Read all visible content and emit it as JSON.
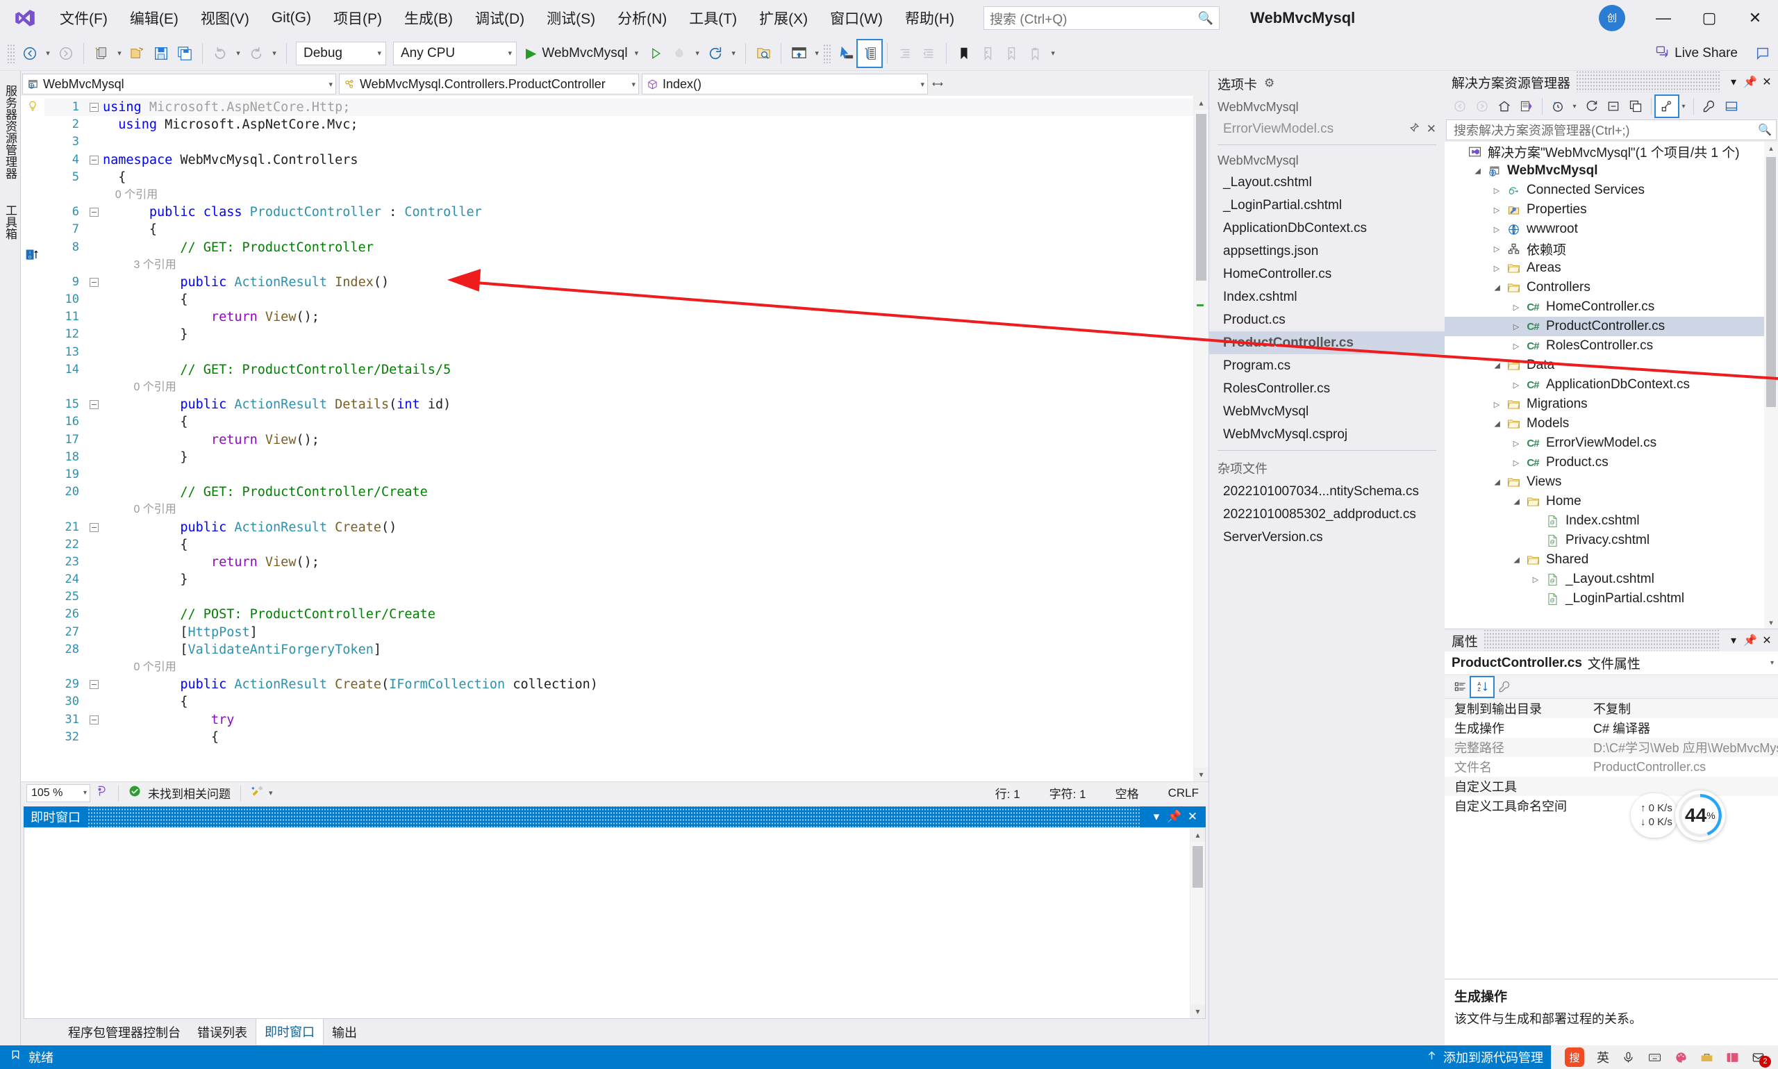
{
  "window": {
    "project_title": "WebMvcMysql",
    "avatar_initials": "创",
    "minimize": "—",
    "maximize": "▢",
    "close": "✕"
  },
  "menu": {
    "items": [
      {
        "label": "文件(F)"
      },
      {
        "label": "编辑(E)"
      },
      {
        "label": "视图(V)"
      },
      {
        "label": "Git(G)"
      },
      {
        "label": "项目(P)"
      },
      {
        "label": "生成(B)"
      },
      {
        "label": "调试(D)"
      },
      {
        "label": "测试(S)"
      },
      {
        "label": "分析(N)"
      },
      {
        "label": "工具(T)"
      },
      {
        "label": "扩展(X)"
      },
      {
        "label": "窗口(W)"
      },
      {
        "label": "帮助(H)"
      }
    ]
  },
  "search": {
    "placeholder": "搜索 (Ctrl+Q)",
    "icon": "search-icon"
  },
  "toolbar": {
    "config": "Debug",
    "platform": "Any CPU",
    "run_target": "WebMvcMysql",
    "live_share": "Live Share",
    "icons": [
      "navigate-back-icon",
      "navigate-forward-icon",
      "new-project-icon",
      "open-file-icon",
      "save-icon",
      "save-all-icon",
      "undo-icon",
      "redo-icon",
      "start-debug-icon",
      "hot-reload-icon",
      "restart-icon",
      "find-in-files-icon",
      "toggle-preview-icon",
      "pointer-select-icon",
      "solution-explorer-icon",
      "indent-icon",
      "outdent-icon",
      "bookmark-icon",
      "prev-bookmark-icon",
      "next-bookmark-icon",
      "clear-bookmarks-icon"
    ]
  },
  "left_dock": {
    "tabs": [
      "服务器资源管理器",
      "工具箱"
    ]
  },
  "navbar": {
    "project": "WebMvcMysql",
    "type": "WebMvcMysql.Controllers.ProductController",
    "member": "Index()",
    "project_icon": "web-project-icon",
    "type_icon": "class-icon",
    "member_icon": "method-icon"
  },
  "editor": {
    "lines": [
      {
        "n": "1",
        "fold": "minus",
        "highlight": true,
        "tokens": [
          {
            "t": "using ",
            "c": "k"
          },
          {
            "t": "Microsoft.AspNetCore.Http;",
            "c": "gray"
          }
        ]
      },
      {
        "n": "2",
        "fold": "",
        "tokens": [
          {
            "t": "  using ",
            "c": "k"
          },
          {
            "t": "Microsoft.AspNetCore.Mvc;",
            "c": "ns"
          }
        ]
      },
      {
        "n": "3",
        "fold": "",
        "tokens": []
      },
      {
        "n": "4",
        "fold": "minus",
        "tokens": [
          {
            "t": "namespace ",
            "c": "k"
          },
          {
            "t": "WebMvcMysql.Controllers",
            "c": "ns"
          }
        ]
      },
      {
        "n": "5",
        "fold": "",
        "tokens": [
          {
            "t": "  {",
            "c": "ns"
          }
        ]
      },
      {
        "n": "",
        "fold": "",
        "ref": "    0 个引用"
      },
      {
        "n": "6",
        "fold": "minus",
        "tokens": [
          {
            "t": "      public class ",
            "c": "k"
          },
          {
            "t": "ProductController",
            "c": "t"
          },
          {
            "t": " : ",
            "c": "ns"
          },
          {
            "t": "Controller",
            "c": "t"
          }
        ]
      },
      {
        "n": "7",
        "fold": "",
        "tokens": [
          {
            "t": "      {",
            "c": "ns"
          }
        ]
      },
      {
        "n": "8",
        "fold": "",
        "tokens": [
          {
            "t": "          // GET: ProductController",
            "c": "cm"
          }
        ]
      },
      {
        "n": "",
        "fold": "",
        "ref": "          3 个引用"
      },
      {
        "n": "9",
        "fold": "minus",
        "tokens": [
          {
            "t": "          public ",
            "c": "k"
          },
          {
            "t": "ActionResult",
            "c": "t"
          },
          {
            "t": " ",
            "c": "ns"
          },
          {
            "t": "Index",
            "c": "mth"
          },
          {
            "t": "()",
            "c": "ns"
          }
        ]
      },
      {
        "n": "10",
        "fold": "",
        "tokens": [
          {
            "t": "          {",
            "c": "ns"
          }
        ]
      },
      {
        "n": "11",
        "fold": "",
        "tokens": [
          {
            "t": "              return ",
            "c": "ctl"
          },
          {
            "t": "View",
            "c": "mth"
          },
          {
            "t": "();",
            "c": "ns"
          }
        ]
      },
      {
        "n": "12",
        "fold": "",
        "tokens": [
          {
            "t": "          }",
            "c": "ns"
          }
        ]
      },
      {
        "n": "13",
        "fold": "",
        "tokens": []
      },
      {
        "n": "14",
        "fold": "",
        "tokens": [
          {
            "t": "          // GET: ProductController/Details/5",
            "c": "cm"
          }
        ]
      },
      {
        "n": "",
        "fold": "",
        "ref": "          0 个引用"
      },
      {
        "n": "15",
        "fold": "minus",
        "tokens": [
          {
            "t": "          public ",
            "c": "k"
          },
          {
            "t": "ActionResult",
            "c": "t"
          },
          {
            "t": " ",
            "c": "ns"
          },
          {
            "t": "Details",
            "c": "mth"
          },
          {
            "t": "(",
            "c": "ns"
          },
          {
            "t": "int",
            "c": "k"
          },
          {
            "t": " ",
            "c": "ns"
          },
          {
            "t": "id",
            "c": "par"
          },
          {
            "t": ")",
            "c": "ns"
          }
        ]
      },
      {
        "n": "16",
        "fold": "",
        "tokens": [
          {
            "t": "          {",
            "c": "ns"
          }
        ]
      },
      {
        "n": "17",
        "fold": "",
        "tokens": [
          {
            "t": "              return ",
            "c": "ctl"
          },
          {
            "t": "View",
            "c": "mth"
          },
          {
            "t": "();",
            "c": "ns"
          }
        ]
      },
      {
        "n": "18",
        "fold": "",
        "tokens": [
          {
            "t": "          }",
            "c": "ns"
          }
        ]
      },
      {
        "n": "19",
        "fold": "",
        "tokens": []
      },
      {
        "n": "20",
        "fold": "",
        "tokens": [
          {
            "t": "          // GET: ProductController/Create",
            "c": "cm"
          }
        ]
      },
      {
        "n": "",
        "fold": "",
        "ref": "          0 个引用"
      },
      {
        "n": "21",
        "fold": "minus",
        "tokens": [
          {
            "t": "          public ",
            "c": "k"
          },
          {
            "t": "ActionResult",
            "c": "t"
          },
          {
            "t": " ",
            "c": "ns"
          },
          {
            "t": "Create",
            "c": "mth"
          },
          {
            "t": "()",
            "c": "ns"
          }
        ]
      },
      {
        "n": "22",
        "fold": "",
        "tokens": [
          {
            "t": "          {",
            "c": "ns"
          }
        ]
      },
      {
        "n": "23",
        "fold": "",
        "tokens": [
          {
            "t": "              return ",
            "c": "ctl"
          },
          {
            "t": "View",
            "c": "mth"
          },
          {
            "t": "();",
            "c": "ns"
          }
        ]
      },
      {
        "n": "24",
        "fold": "",
        "tokens": [
          {
            "t": "          }",
            "c": "ns"
          }
        ]
      },
      {
        "n": "25",
        "fold": "",
        "tokens": []
      },
      {
        "n": "26",
        "fold": "",
        "tokens": [
          {
            "t": "          // POST: ProductController/Create",
            "c": "cm"
          }
        ]
      },
      {
        "n": "27",
        "fold": "",
        "tokens": [
          {
            "t": "          [",
            "c": "ns"
          },
          {
            "t": "HttpPost",
            "c": "t"
          },
          {
            "t": "]",
            "c": "ns"
          }
        ]
      },
      {
        "n": "28",
        "fold": "",
        "tokens": [
          {
            "t": "          [",
            "c": "ns"
          },
          {
            "t": "ValidateAntiForgeryToken",
            "c": "t"
          },
          {
            "t": "]",
            "c": "ns"
          }
        ]
      },
      {
        "n": "",
        "fold": "",
        "ref": "          0 个引用"
      },
      {
        "n": "29",
        "fold": "minus",
        "tokens": [
          {
            "t": "          public ",
            "c": "k"
          },
          {
            "t": "ActionResult",
            "c": "t"
          },
          {
            "t": " ",
            "c": "ns"
          },
          {
            "t": "Create",
            "c": "mth"
          },
          {
            "t": "(",
            "c": "ns"
          },
          {
            "t": "IFormCollection",
            "c": "t"
          },
          {
            "t": " collection)",
            "c": "ns"
          }
        ]
      },
      {
        "n": "30",
        "fold": "",
        "tokens": [
          {
            "t": "          {",
            "c": "ns"
          }
        ]
      },
      {
        "n": "31",
        "fold": "minus",
        "tokens": [
          {
            "t": "              try",
            "c": "ctl"
          }
        ]
      },
      {
        "n": "32",
        "fold": "",
        "tokens": [
          {
            "t": "              {",
            "c": "ns"
          }
        ]
      }
    ],
    "status": {
      "zoom": "105 %",
      "issues": "未找到相关问题",
      "line_label": "行: 1",
      "col_label": "字符: 1",
      "spaces": "空格",
      "eol": "CRLF"
    }
  },
  "immediate_window": {
    "title": "即时窗口",
    "tabs": [
      {
        "label": "程序包管理器控制台",
        "selected": false
      },
      {
        "label": "错误列表",
        "selected": false
      },
      {
        "label": "即时窗口",
        "selected": true
      },
      {
        "label": "输出",
        "selected": false
      }
    ],
    "header_buttons": [
      "chevron-down-icon",
      "pin-icon",
      "close-icon"
    ]
  },
  "tab_well": {
    "title": "选项卡",
    "gear": "gear-icon",
    "groups": [
      {
        "name": "WebMvcMysql",
        "items": [
          {
            "label": "ErrorViewModel.cs",
            "dim": true,
            "selected": false,
            "has_pin": true,
            "has_close": true
          }
        ]
      },
      {
        "name": "WebMvcMysql",
        "items": [
          {
            "label": "_Layout.cshtml",
            "dim": false,
            "selected": false
          },
          {
            "label": "_LoginPartial.cshtml",
            "dim": false,
            "selected": false
          },
          {
            "label": "ApplicationDbContext.cs",
            "dim": false,
            "selected": false
          },
          {
            "label": "appsettings.json",
            "dim": false,
            "selected": false
          },
          {
            "label": "HomeController.cs",
            "dim": false,
            "selected": false
          },
          {
            "label": "Index.cshtml",
            "dim": false,
            "selected": false
          },
          {
            "label": "Product.cs",
            "dim": false,
            "selected": false
          },
          {
            "label": "ProductController.cs",
            "dim": false,
            "selected": true
          },
          {
            "label": "Program.cs",
            "dim": false,
            "selected": false
          },
          {
            "label": "RolesController.cs",
            "dim": false,
            "selected": false
          },
          {
            "label": "WebMvcMysql",
            "dim": false,
            "selected": false
          },
          {
            "label": "WebMvcMysql.csproj",
            "dim": false,
            "selected": false
          }
        ]
      },
      {
        "name": "杂项文件",
        "items": [
          {
            "label": "2022101007034...ntitySchema.cs",
            "dim": false,
            "selected": false
          },
          {
            "label": "20221010085302_addproduct.cs",
            "dim": false,
            "selected": false
          },
          {
            "label": "ServerVersion.cs",
            "dim": false,
            "selected": false
          }
        ]
      }
    ]
  },
  "solution_explorer": {
    "title": "解决方案资源管理器",
    "search_placeholder": "搜索解决方案资源管理器(Ctrl+;)",
    "toolbar_icons": [
      "back-icon",
      "forward-icon",
      "home-icon",
      "pending-changes-icon",
      "show-all-files-icon",
      "refresh-icon",
      "collapse-all-icon",
      "new-folder-icon",
      "properties-view-icon",
      "properties-icon",
      "preview-icon"
    ],
    "tree": [
      {
        "depth": 0,
        "arrow": "",
        "icon": "solution-icon",
        "label": "解决方案\"WebMvcMysql\"(1 个项目/共 1 个)",
        "bold": false,
        "selected": false
      },
      {
        "depth": 1,
        "arrow": "open",
        "icon": "web-project-icon",
        "label": "WebMvcMysql",
        "bold": true,
        "selected": false
      },
      {
        "depth": 2,
        "arrow": "closed",
        "icon": "connected-services-icon",
        "label": "Connected Services",
        "bold": false,
        "selected": false
      },
      {
        "depth": 2,
        "arrow": "closed",
        "icon": "properties-folder-icon",
        "label": "Properties",
        "bold": false,
        "selected": false
      },
      {
        "depth": 2,
        "arrow": "closed",
        "icon": "wwwroot-icon",
        "label": "wwwroot",
        "bold": false,
        "selected": false
      },
      {
        "depth": 2,
        "arrow": "closed",
        "icon": "dependencies-icon",
        "label": "依赖项",
        "bold": false,
        "selected": false
      },
      {
        "depth": 2,
        "arrow": "closed",
        "icon": "folder-icon",
        "label": "Areas",
        "bold": false,
        "selected": false
      },
      {
        "depth": 2,
        "arrow": "open",
        "icon": "folder-icon",
        "label": "Controllers",
        "bold": false,
        "selected": false
      },
      {
        "depth": 3,
        "arrow": "closed",
        "icon": "csharp-file-icon",
        "label": "HomeController.cs",
        "bold": false,
        "selected": false
      },
      {
        "depth": 3,
        "arrow": "closed",
        "icon": "csharp-file-icon",
        "label": "ProductController.cs",
        "bold": false,
        "selected": true
      },
      {
        "depth": 3,
        "arrow": "closed",
        "icon": "csharp-file-icon",
        "label": "RolesController.cs",
        "bold": false,
        "selected": false
      },
      {
        "depth": 2,
        "arrow": "open",
        "icon": "folder-icon",
        "label": "Data",
        "bold": false,
        "selected": false
      },
      {
        "depth": 3,
        "arrow": "closed",
        "icon": "csharp-file-icon",
        "label": "ApplicationDbContext.cs",
        "bold": false,
        "selected": false
      },
      {
        "depth": 2,
        "arrow": "closed",
        "icon": "folder-icon",
        "label": "Migrations",
        "bold": false,
        "selected": false
      },
      {
        "depth": 2,
        "arrow": "open",
        "icon": "folder-icon",
        "label": "Models",
        "bold": false,
        "selected": false
      },
      {
        "depth": 3,
        "arrow": "closed",
        "icon": "csharp-file-icon",
        "label": "ErrorViewModel.cs",
        "bold": false,
        "selected": false
      },
      {
        "depth": 3,
        "arrow": "closed",
        "icon": "csharp-file-icon",
        "label": "Product.cs",
        "bold": false,
        "selected": false
      },
      {
        "depth": 2,
        "arrow": "open",
        "icon": "folder-icon",
        "label": "Views",
        "bold": false,
        "selected": false
      },
      {
        "depth": 3,
        "arrow": "open",
        "icon": "folder-icon",
        "label": "Home",
        "bold": false,
        "selected": false
      },
      {
        "depth": 4,
        "arrow": "",
        "icon": "razor-file-icon",
        "label": "Index.cshtml",
        "bold": false,
        "selected": false
      },
      {
        "depth": 4,
        "arrow": "",
        "icon": "razor-file-icon",
        "label": "Privacy.cshtml",
        "bold": false,
        "selected": false
      },
      {
        "depth": 3,
        "arrow": "open",
        "icon": "folder-icon",
        "label": "Shared",
        "bold": false,
        "selected": false
      },
      {
        "depth": 4,
        "arrow": "closed",
        "icon": "razor-file-icon",
        "label": "_Layout.cshtml",
        "bold": false,
        "selected": false
      },
      {
        "depth": 4,
        "arrow": "",
        "icon": "razor-file-icon",
        "label": "_LoginPartial.cshtml",
        "bold": false,
        "selected": false
      }
    ]
  },
  "properties": {
    "title": "属性",
    "object_name": "ProductController.cs",
    "object_kind": "文件属性",
    "rows": [
      {
        "key": "复制到输出目录",
        "value": "不复制",
        "dim": false
      },
      {
        "key": "生成操作",
        "value": "C# 编译器",
        "dim": false
      },
      {
        "key": "完整路径",
        "value": "D:\\C#学习\\Web 应用\\WebMvcMysql\\WebM\\",
        "dim": true
      },
      {
        "key": "文件名",
        "value": "ProductController.cs",
        "dim": true
      },
      {
        "key": "自定义工具",
        "value": "",
        "dim": false
      },
      {
        "key": "自定义工具命名空间",
        "value": "",
        "dim": false
      }
    ],
    "description_title": "生成操作",
    "description_text": "该文件与生成和部署过程的关系。"
  },
  "network_widget": {
    "up": "↑ 0   K/s",
    "down": "↓ 0   K/s",
    "percent": "44",
    "percent_unit": "%"
  },
  "status_bar": {
    "state": "就绪",
    "add_to_source": "添加到源代码管理",
    "tray_items": [
      "sogou-icon",
      "ime-english-icon",
      "mic-icon",
      "keyboard-icon",
      "palette-icon",
      "toolbox-icon",
      "layout-icon",
      "notification-icon"
    ],
    "notification_count": "2",
    "ime_label": "英"
  },
  "colors": {
    "accent": "#007acc",
    "title_bg": "#eeeef2",
    "selection": "#cfd6e6",
    "annotation_red": "#ee1c1c"
  }
}
